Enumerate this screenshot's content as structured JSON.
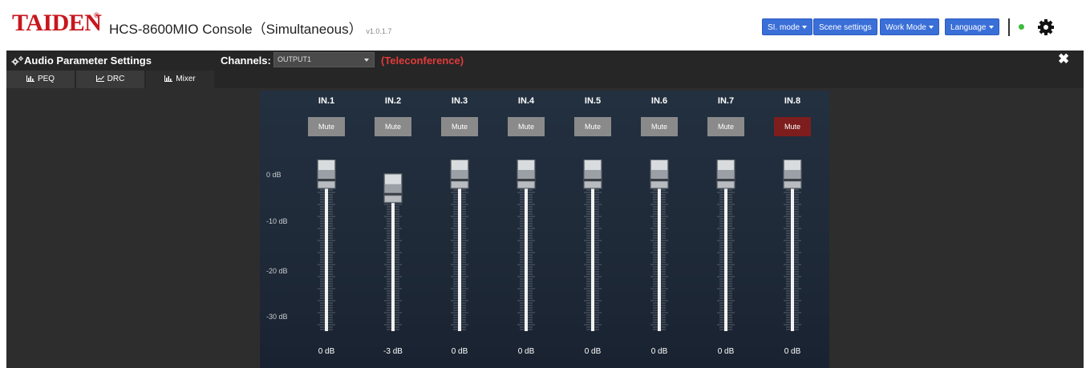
{
  "header": {
    "logo": "TAIDEN",
    "logo_mark": "®",
    "app_title": "HCS-8600MIO Console（Simultaneous）",
    "version": "v1.0.1.7",
    "buttons": {
      "si_mode": "SI. mode",
      "scene_settings": "Scene settings",
      "work_mode": "Work Mode",
      "language": "Language"
    },
    "status_color": "#3dbb3d",
    "settings_icon": "gear-icon"
  },
  "panel": {
    "title": "Audio Parameter Settings",
    "title_icon": "cogs-icon",
    "channels_label": "Channels:",
    "channel_value": "OUTPUT1",
    "channel_mode": "(Teleconference)",
    "close_icon": "close-icon"
  },
  "tabs": [
    {
      "label": "PEQ",
      "icon": "bar-chart-icon"
    },
    {
      "label": "DRC",
      "icon": "line-chart-icon"
    },
    {
      "label": "Mixer",
      "icon": "bar-chart-icon"
    }
  ],
  "mixer": {
    "scale": [
      "0 dB",
      "-10 dB",
      "-20 dB",
      "-30 dB"
    ],
    "mute_label": "Mute",
    "muted_color": "#7e1d1d",
    "channels": [
      {
        "name": "IN.1",
        "value": "0 dB",
        "level_db": 0,
        "muted": false
      },
      {
        "name": "IN.2",
        "value": "-3 dB",
        "level_db": -3,
        "muted": false
      },
      {
        "name": "IN.3",
        "value": "0 dB",
        "level_db": 0,
        "muted": false
      },
      {
        "name": "IN.4",
        "value": "0 dB",
        "level_db": 0,
        "muted": false
      },
      {
        "name": "IN.5",
        "value": "0 dB",
        "level_db": 0,
        "muted": false
      },
      {
        "name": "IN.6",
        "value": "0 dB",
        "level_db": 0,
        "muted": false
      },
      {
        "name": "IN.7",
        "value": "0 dB",
        "level_db": 0,
        "muted": false
      },
      {
        "name": "IN.8",
        "value": "0 dB",
        "level_db": 0,
        "muted": true
      }
    ]
  }
}
